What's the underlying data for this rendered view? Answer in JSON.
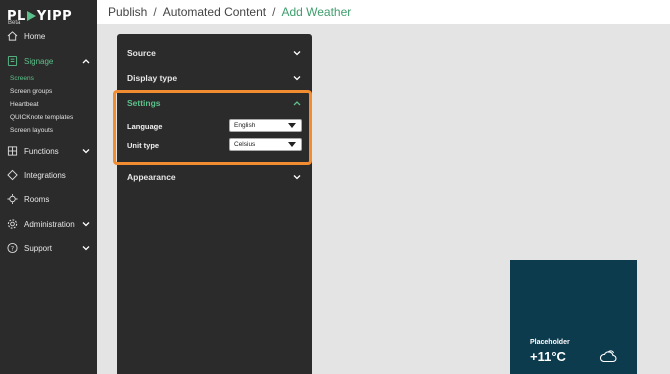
{
  "brand": {
    "logo_left": "PL",
    "logo_right": "YIPP",
    "badge": "Beta",
    "accent": "#5cc08a"
  },
  "sidebar": {
    "items": [
      {
        "label": "Home",
        "icon": "home-icon"
      },
      {
        "label": "Signage",
        "icon": "signage-icon",
        "expanded": true
      },
      {
        "label": "Functions",
        "icon": "functions-icon"
      },
      {
        "label": "Integrations",
        "icon": "integrations-icon"
      },
      {
        "label": "Rooms",
        "icon": "rooms-icon"
      },
      {
        "label": "Administration",
        "icon": "administration-icon"
      },
      {
        "label": "Support",
        "icon": "support-icon"
      }
    ],
    "signage_sub": [
      "Screens",
      "Screen groups",
      "Heartbeat",
      "QUICKnote templates",
      "Screen layouts"
    ]
  },
  "breadcrumb": {
    "part1": "Publish",
    "part2": "Automated Content",
    "part3": "Add Weather",
    "separator": "/"
  },
  "panel": {
    "sections": {
      "source": "Source",
      "display_type": "Display type",
      "settings": "Settings",
      "appearance": "Appearance"
    },
    "settings": {
      "language_label": "Language",
      "language_value": "English",
      "unit_label": "Unit type",
      "unit_value": "Celsius"
    },
    "highlight_color": "#f28c30"
  },
  "preview": {
    "label": "Placeholder",
    "temperature": "+11°C",
    "icon": "cloud-icon",
    "background": "#0d3b4e"
  }
}
